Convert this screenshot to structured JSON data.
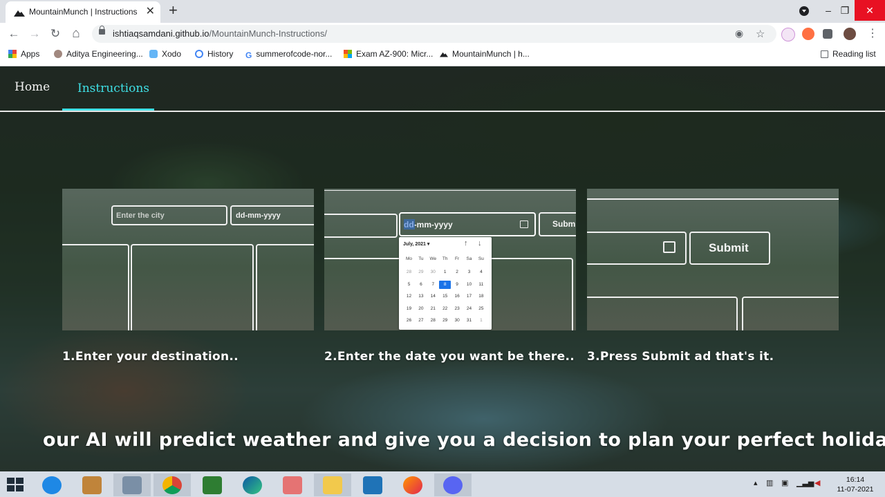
{
  "browser": {
    "tab_title": "MountainMunch | Instructions",
    "tab_close": "✕",
    "new_tab": "+",
    "url_host": "ishtiaqsamdani.github.io",
    "url_path": "/MountainMunch-Instructions/",
    "window_controls": {
      "minimize": "–",
      "restore": "❐",
      "close": "✕"
    },
    "nav_icons": {
      "back": "←",
      "forward": "→",
      "reload": "↻",
      "home": "⌂"
    },
    "bookmarks": [
      {
        "label": "Apps",
        "icon": "apps-grid-icon",
        "color": "#e8453c"
      },
      {
        "label": "Aditya Engineering...",
        "icon": "aditya-icon",
        "color": "#8d6e63"
      },
      {
        "label": "Xodo",
        "icon": "xodo-icon",
        "color": "#2196f3"
      },
      {
        "label": "History",
        "icon": "history-icon",
        "color": "#4285f4"
      },
      {
        "label": "summerofcode-nor...",
        "icon": "google-icon",
        "color": "#4285f4"
      },
      {
        "label": "Exam AZ-900: Micr...",
        "icon": "microsoft-icon",
        "color": "#f25022"
      },
      {
        "label": "MountainMunch | h...",
        "icon": "mountain-icon",
        "color": "#202124"
      }
    ],
    "reading_list": "Reading list"
  },
  "nav": {
    "home": "Home",
    "instructions": "Instructions",
    "accent": "#3fe0e6"
  },
  "step1": {
    "city_placeholder": "Enter the city",
    "date_placeholder": "dd-mm-yyyy",
    "caption": "1.Enter your destination.."
  },
  "step2": {
    "date_value": "dd-mm-yyyy",
    "submit_partial": "Subm",
    "calendar": {
      "month": "July, 2021 ▾",
      "weekdays": [
        "Mo",
        "Tu",
        "We",
        "Th",
        "Fr",
        "Sa",
        "Su"
      ],
      "weeks": [
        [
          "28",
          "29",
          "30",
          "1",
          "2",
          "3",
          "4"
        ],
        [
          "5",
          "6",
          "7",
          "8",
          "9",
          "10",
          "11"
        ],
        [
          "12",
          "13",
          "14",
          "15",
          "16",
          "17",
          "18"
        ],
        [
          "19",
          "20",
          "21",
          "22",
          "23",
          "24",
          "25"
        ],
        [
          "26",
          "27",
          "28",
          "29",
          "30",
          "31",
          "1"
        ]
      ],
      "selected": "8"
    },
    "caption": "2.Enter the date you want be there.."
  },
  "step3": {
    "submit": "Submit",
    "caption": "3.Press Submit ad that's it."
  },
  "tagline": "our AI will predict weather and give you a decision to plan your perfect holiday..",
  "taskbar": {
    "apps": [
      "internet-explorer-icon",
      "control-panel-icon",
      "paint-icon",
      "chrome-icon",
      "store-icon",
      "edge-icon",
      "snipping-icon",
      "file-explorer-icon",
      "vscode-icon",
      "firefox-icon",
      "discord-icon"
    ],
    "time": "16:14",
    "date": "11-07-2021"
  }
}
